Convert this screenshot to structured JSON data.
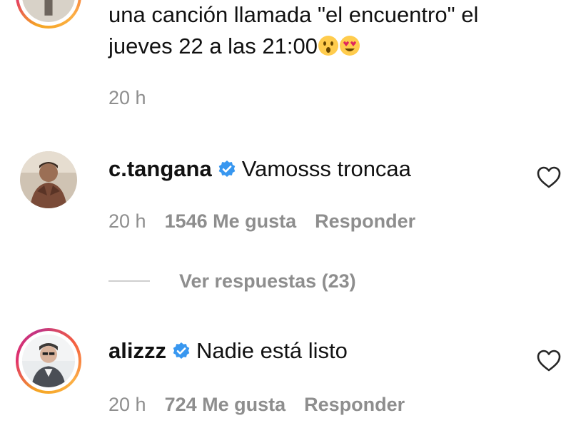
{
  "comment_top": {
    "line1": "una canción llamada \"el encuentro\" el",
    "line2": "jueves 22 a las 21:00",
    "emoji_1": "astonished-face-emoji",
    "emoji_2": "heart-eyes-emoji",
    "time": "20 h"
  },
  "comment_tangana": {
    "username": "c.tangana",
    "text": "Vamosss troncaa",
    "time": "20 h",
    "likes": "1546 Me gusta",
    "reply_label": "Responder",
    "view_replies": "Ver respuestas (23)"
  },
  "comment_alizzz": {
    "username": "alizzz",
    "text": "Nadie está listo",
    "time": "20 h",
    "likes": "724 Me gusta",
    "reply_label": "Responder"
  },
  "colors": {
    "text_primary": "#111111",
    "text_secondary": "#8e8e8e",
    "verified_blue": "#3897f0",
    "story_ring": "#e1306c"
  },
  "icons": {
    "verified": "verified-badge-icon",
    "like": "heart-outline-icon"
  }
}
